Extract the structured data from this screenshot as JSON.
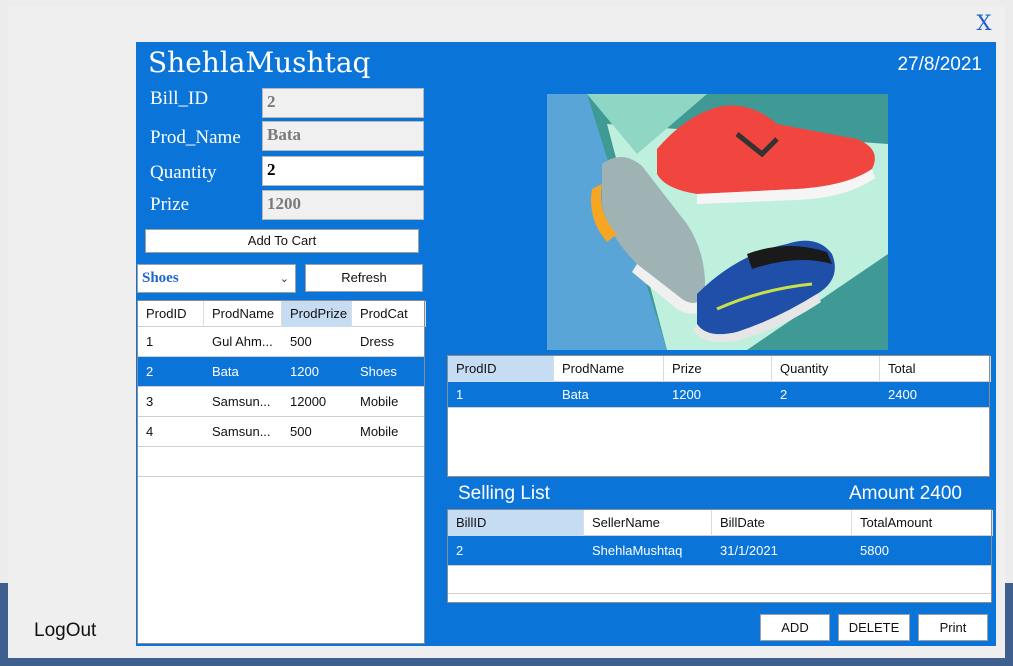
{
  "window": {
    "close_label": "X"
  },
  "header": {
    "username": "ShehlaMushtaq",
    "date": "27/8/2021"
  },
  "form": {
    "bill_id_label": "Bill_ID",
    "bill_id_value": "2",
    "prod_name_label": "Prod_Name",
    "prod_name_value": "Bata",
    "quantity_label": "Quantity",
    "quantity_value": "2",
    "prize_label": "Prize",
    "prize_value": "1200",
    "add_to_cart_label": "Add To Cart",
    "category_selected": "Shoes",
    "refresh_label": "Refresh"
  },
  "products_grid": {
    "columns": [
      "ProdID",
      "ProdName",
      "ProdPrize",
      "ProdCat"
    ],
    "rows": [
      [
        "1",
        "Gul Ahm...",
        "500",
        "Dress"
      ],
      [
        "2",
        "Bata",
        "1200",
        "Shoes"
      ],
      [
        "3",
        "Samsun...",
        "12000",
        "Mobile"
      ],
      [
        "4",
        "Samsun...",
        "500",
        "Mobile"
      ]
    ]
  },
  "cart_grid": {
    "columns": [
      "ProdID",
      "ProdName",
      "Prize",
      "Quantity",
      "Total"
    ],
    "rows": [
      [
        "1",
        "Bata",
        "1200",
        "2",
        "2400"
      ]
    ]
  },
  "selling": {
    "title": "Selling List",
    "amount_label": "Amount 2400"
  },
  "bills_grid": {
    "columns": [
      "BillID",
      "SellerName",
      "BillDate",
      "TotalAmount"
    ],
    "rows": [
      [
        "2",
        "ShehlaMushtaq",
        "31/1/2021",
        "5800"
      ]
    ]
  },
  "actions": {
    "add_label": "ADD",
    "delete_label": "DELETE",
    "print_label": "Print"
  },
  "footer": {
    "logout_label": "LogOut"
  },
  "image": {
    "icon": "sneakers-product-photo"
  }
}
